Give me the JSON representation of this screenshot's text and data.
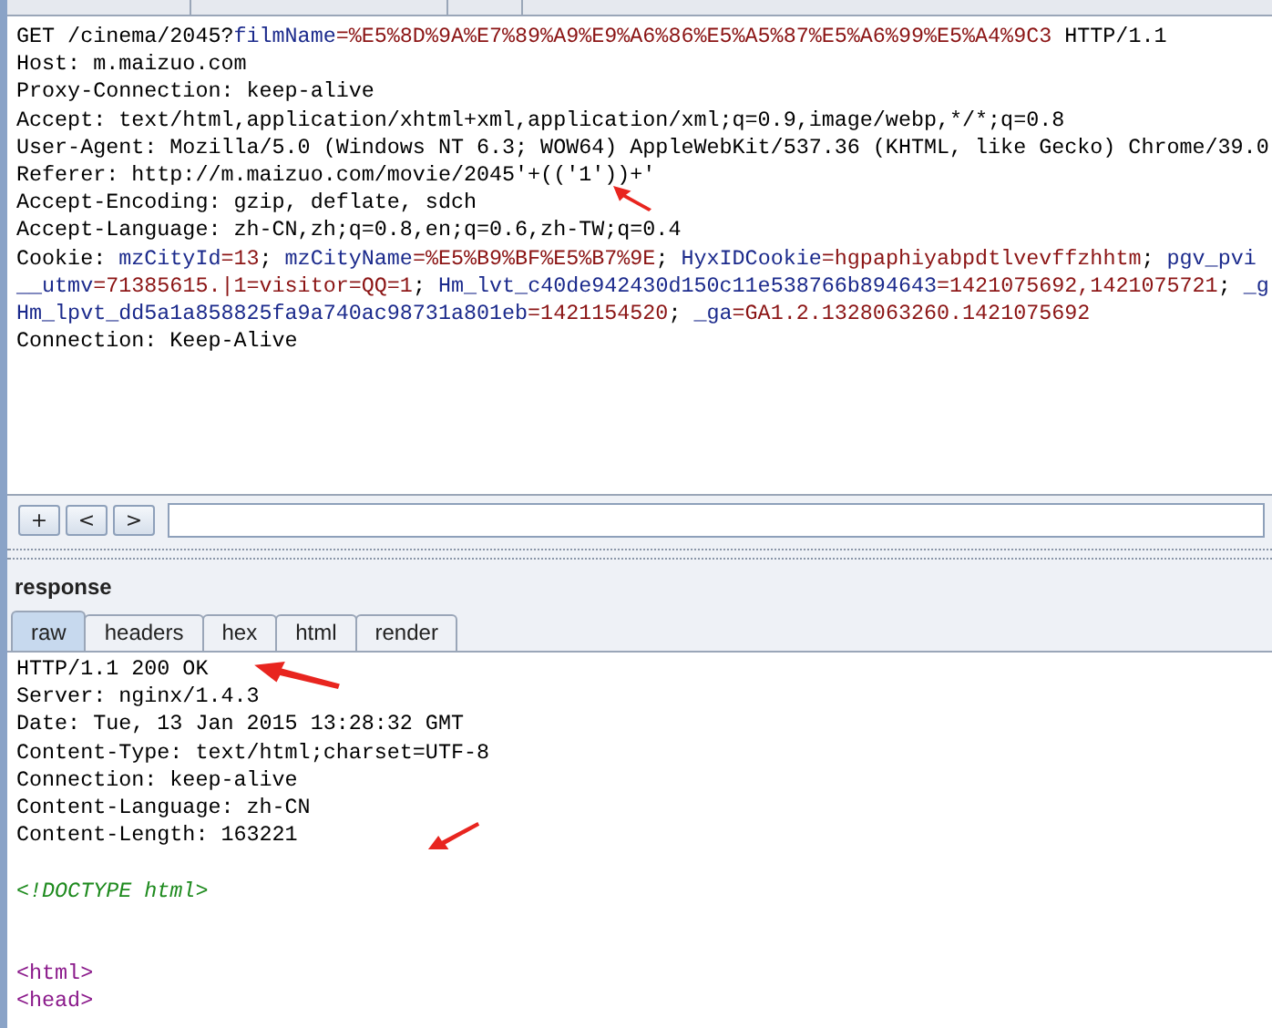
{
  "request": {
    "lines": [
      [
        {
          "kind": "plain",
          "text": "GET /cinema/2045?"
        },
        {
          "kind": "name",
          "text": "filmName"
        },
        {
          "kind": "value",
          "text": "=%E5%8D%9A%E7%89%A9%E9%A6%86%E5%A5%87%E5%A6%99%E5%A4%9C3"
        },
        {
          "kind": "plain",
          "text": " HTTP/1.1"
        }
      ],
      [
        {
          "kind": "plain",
          "text": "Host: m.maizuo.com"
        }
      ],
      [
        {
          "kind": "plain",
          "text": "Proxy-Connection: keep-alive"
        }
      ],
      [
        {
          "kind": "plain",
          "text": "Accept: text/html,application/xhtml+xml,application/xml;q=0.9,image/webp,*/*;q=0.8"
        }
      ],
      [
        {
          "kind": "plain",
          "text": "User-Agent: Mozilla/5.0 (Windows NT 6.3; WOW64) AppleWebKit/537.36 (KHTML, like Gecko) Chrome/39.0"
        }
      ],
      [
        {
          "kind": "plain",
          "text": "Referer: http://m.maizuo.com/movie/2045'+(('1'))+'"
        }
      ],
      [
        {
          "kind": "plain",
          "text": "Accept-Encoding: gzip, deflate, sdch"
        }
      ],
      [
        {
          "kind": "plain",
          "text": "Accept-Language: zh-CN,zh;q=0.8,en;q=0.6,zh-TW;q=0.4"
        }
      ],
      [
        {
          "kind": "plain",
          "text": "Cookie: "
        },
        {
          "kind": "name",
          "text": "mzCityId"
        },
        {
          "kind": "value",
          "text": "=13"
        },
        {
          "kind": "plain",
          "text": "; "
        },
        {
          "kind": "name",
          "text": "mzCityName"
        },
        {
          "kind": "value",
          "text": "=%E5%B9%BF%E5%B7%9E"
        },
        {
          "kind": "plain",
          "text": "; "
        },
        {
          "kind": "name",
          "text": "HyxIDCookie"
        },
        {
          "kind": "value",
          "text": "=hgpaphiyabpdtlvevffzhhtm"
        },
        {
          "kind": "plain",
          "text": "; "
        },
        {
          "kind": "name",
          "text": "pgv_pvi"
        }
      ],
      [
        {
          "kind": "name",
          "text": "__utmv"
        },
        {
          "kind": "value",
          "text": "=71385615.|1=visitor=QQ=1"
        },
        {
          "kind": "plain",
          "text": "; "
        },
        {
          "kind": "name",
          "text": "Hm_lvt_c40de942430d150c11e538766b894643"
        },
        {
          "kind": "value",
          "text": "=1421075692,1421075721"
        },
        {
          "kind": "plain",
          "text": "; "
        },
        {
          "kind": "name",
          "text": "_g"
        }
      ],
      [
        {
          "kind": "name",
          "text": "Hm_lpvt_dd5a1a858825fa9a740ac98731a801eb"
        },
        {
          "kind": "value",
          "text": "=1421154520"
        },
        {
          "kind": "plain",
          "text": "; "
        },
        {
          "kind": "name",
          "text": "_ga"
        },
        {
          "kind": "value",
          "text": "=GA1.2.1328063260.1421075692"
        }
      ],
      [
        {
          "kind": "plain",
          "text": "Connection: Keep-Alive"
        }
      ]
    ]
  },
  "toolbar": {
    "buttons": [
      "+",
      "<",
      ">"
    ]
  },
  "response": {
    "title": "response",
    "tabs": [
      {
        "label": "raw",
        "selected": true
      },
      {
        "label": "headers",
        "selected": false
      },
      {
        "label": "hex",
        "selected": false
      },
      {
        "label": "html",
        "selected": false
      },
      {
        "label": "render",
        "selected": false
      }
    ],
    "lines": [
      {
        "kind": "plain",
        "text": "HTTP/1.1 200 OK"
      },
      {
        "kind": "plain",
        "text": "Server: nginx/1.4.3"
      },
      {
        "kind": "plain",
        "text": "Date: Tue, 13 Jan 2015 13:28:32 GMT"
      },
      {
        "kind": "plain",
        "text": "Content-Type: text/html;charset=UTF-8"
      },
      {
        "kind": "plain",
        "text": "Connection: keep-alive"
      },
      {
        "kind": "plain",
        "text": "Content-Language: zh-CN"
      },
      {
        "kind": "plain",
        "text": "Content-Length: 163221"
      },
      {
        "kind": "blank"
      },
      {
        "kind": "doctype",
        "text": "<!DOCTYPE html>"
      },
      {
        "kind": "blank"
      },
      {
        "kind": "blank"
      },
      {
        "kind": "tag",
        "text": "<html>"
      },
      {
        "kind": "tag",
        "text": "<head>"
      }
    ]
  }
}
